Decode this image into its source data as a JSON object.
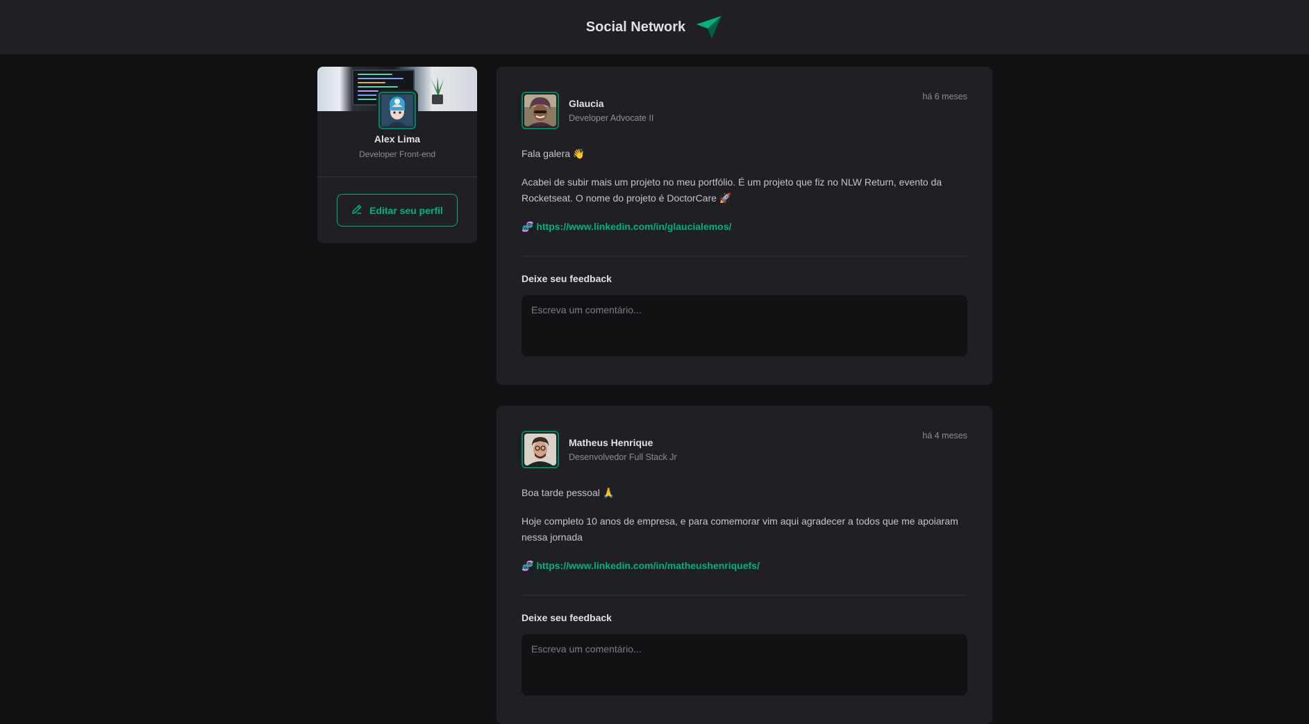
{
  "header": {
    "title": "Social Network",
    "logo_icon": "paper-plane-icon",
    "accent": "#00b37e"
  },
  "sidebar": {
    "name": "Alex Lima",
    "role": "Developer Front-end",
    "edit_button_label": "Editar seu perfil",
    "edit_icon": "pencil-icon"
  },
  "posts": [
    {
      "author": "Glaucia",
      "role": "Developer Advocate II",
      "time": "há 6 meses",
      "greeting": "Fala galera 👋",
      "body": "Acabei de subir mais um projeto no meu portfólio. É um projeto que fiz no NLW Return, evento da Rocketseat. O nome do projeto é DoctorCare 🚀",
      "link_prefix": "🧬",
      "link": "https://www.linkedin.com/in/glaucialemos/",
      "feedback_title": "Deixe seu feedback",
      "comment_placeholder": "Escreva um comentário..."
    },
    {
      "author": "Matheus Henrique",
      "role": "Desenvolvedor Full Stack Jr",
      "time": "há 4 meses",
      "greeting": "Boa tarde pessoal 🙏",
      "body": "Hoje completo 10 anos de empresa, e para comemorar vim aqui agradecer a todos que me apoiaram nessa jornada",
      "link_prefix": "🧬",
      "link": "https://www.linkedin.com/in/matheushenriquefs/",
      "feedback_title": "Deixe seu feedback",
      "comment_placeholder": "Escreva um comentário..."
    }
  ]
}
